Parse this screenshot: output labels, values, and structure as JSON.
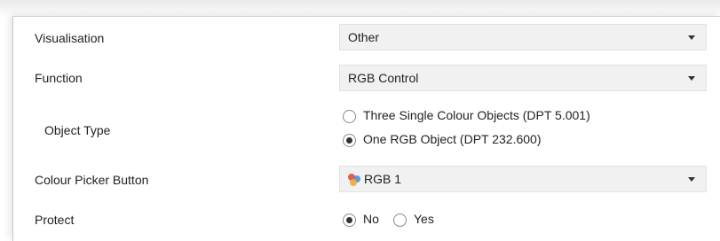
{
  "rows": {
    "visualisation": {
      "label": "Visualisation",
      "value": "Other"
    },
    "function": {
      "label": "Function",
      "value": "RGB Control"
    },
    "object_type": {
      "label": "Object Type",
      "options": [
        {
          "label": "Three Single Colour Objects (DPT 5.001)",
          "checked": false
        },
        {
          "label": "One RGB Object (DPT 232.600)",
          "checked": true
        }
      ]
    },
    "colour_picker": {
      "label": "Colour Picker Button",
      "value": "RGB 1",
      "icon": "rgb-colour-icon",
      "icon_colors": [
        "#e84a3c",
        "#4a8fd9",
        "#f2a93b"
      ]
    },
    "protect": {
      "label": "Protect",
      "options": [
        {
          "label": "No",
          "checked": true
        },
        {
          "label": "Yes",
          "checked": false
        }
      ]
    }
  }
}
